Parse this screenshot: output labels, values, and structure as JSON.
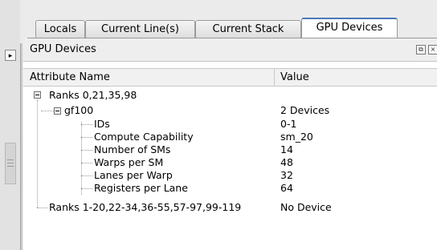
{
  "tabs": [
    {
      "label": "Locals",
      "active": false
    },
    {
      "label": "Current Line(s)",
      "active": false
    },
    {
      "label": "Current Stack",
      "active": false
    },
    {
      "label": "GPU Devices",
      "active": true
    }
  ],
  "panel": {
    "title": "GPU Devices"
  },
  "table": {
    "headers": {
      "name": "Attribute Name",
      "value": "Value"
    },
    "rows": [
      {
        "name": "Ranks 0,21,35,98",
        "value": ""
      },
      {
        "name": "gf100",
        "value": "2 Devices"
      },
      {
        "name": "IDs",
        "value": "0-1"
      },
      {
        "name": "Compute Capability",
        "value": "sm_20"
      },
      {
        "name": "Number of SMs",
        "value": "14"
      },
      {
        "name": "Warps per SM",
        "value": "48"
      },
      {
        "name": "Lanes per Warp",
        "value": "32"
      },
      {
        "name": "Registers per Lane",
        "value": "64"
      },
      {
        "name": "Ranks 1-20,22-34,36-55,57-97,99-119",
        "value": "No Device"
      }
    ]
  },
  "colors": {
    "active_tab_accent": "#4a78b8",
    "panel_bg": "#ffffff",
    "window_bg": "#ebebeb"
  }
}
